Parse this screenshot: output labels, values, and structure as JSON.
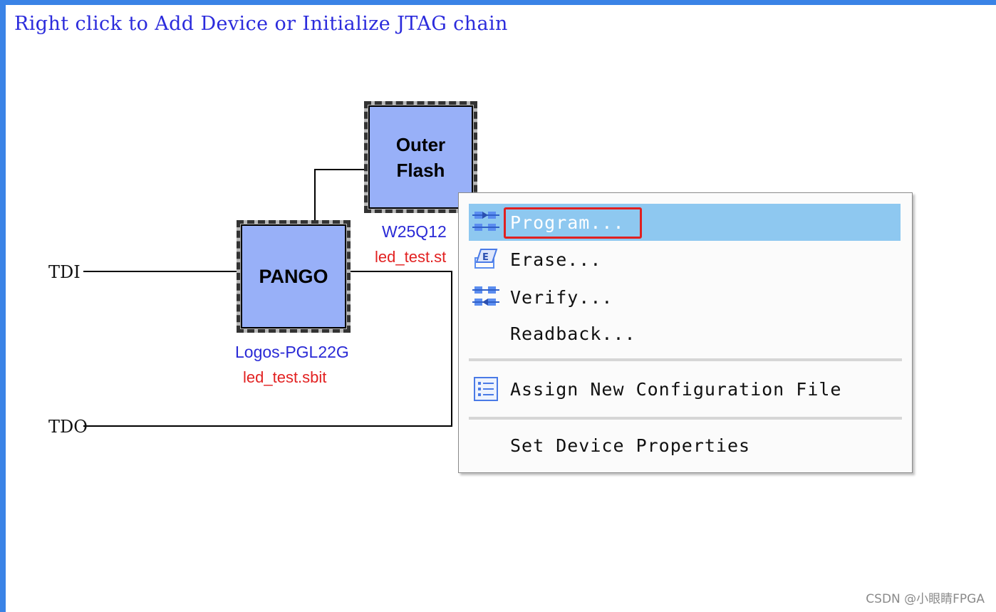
{
  "canvas": {
    "hint": "Right click to Add Device or Initialize JTAG chain",
    "pins": {
      "tdi": "TDI",
      "tdo": "TDO"
    },
    "devices": [
      {
        "chip_lines": [
          "PANGO"
        ],
        "name": "Logos-PGL22G",
        "file": "led_test.sbit"
      },
      {
        "chip_lines": [
          "Outer",
          "Flash"
        ],
        "name": "W25Q12",
        "file": "led_test.st"
      }
    ]
  },
  "context_menu": {
    "items": [
      {
        "label": "Program...",
        "icon": "program-icon"
      },
      {
        "label": "Erase...",
        "icon": "erase-icon"
      },
      {
        "label": "Verify...",
        "icon": "verify-icon"
      },
      {
        "label": "Readback...",
        "icon": ""
      },
      {
        "label": "Assign New Configuration File",
        "icon": "list-icon"
      },
      {
        "label": "Set Device Properties",
        "icon": ""
      }
    ],
    "selected_index": 0
  },
  "watermark": "CSDN @小眼睛FPGA",
  "colors": {
    "frame": "#3a83e6",
    "chip_fill": "#98b0f8",
    "hint_text": "#2b2bdc",
    "device_name": "#2a2ad6",
    "device_file": "#e22121",
    "menu_selected": "#8ec8f0",
    "highlight_box": "#e02020"
  }
}
